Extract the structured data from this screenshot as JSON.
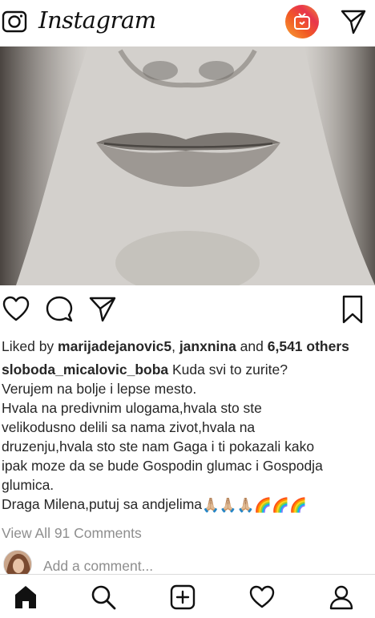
{
  "header": {
    "logo_text": "Instagram",
    "camera_icon": "camera-icon",
    "igtv_icon": "igtv-icon",
    "direct_icon": "paper-plane-icon",
    "igtv_color": "#f15a24"
  },
  "post": {
    "image_description_icon": "post-photo",
    "actions": [
      "heart-icon",
      "comment-icon",
      "share-icon",
      "bookmark-icon"
    ],
    "liked_prefix": "Liked by ",
    "liked_user1": "marijadejanovic5",
    "liked_sep": ", ",
    "liked_user2": "janxnina",
    "liked_and": " and ",
    "liked_count": "6,541 others",
    "caption_user": "sloboda_micalovic_boba",
    "caption_lines": [
      " Kuda svi to zurite?",
      "Verujem na bolje i lepse mesto.",
      "Hvala na predivnim ulogama,hvala sto ste",
      "velikodusno delili sa nama zivot,hvala na",
      "druzenju,hvala sto ste nam Gaga i ti pokazali kako",
      "ipak moze da se bude Gospodin glumac i Gospodja",
      "glumica.",
      "Draga Milena,putuj sa andjelima"
    ],
    "caption_emojis": "🙏🏼🙏🏼🙏🏼🌈🌈🌈",
    "view_all": "View All 91 Comments",
    "add_comment_placeholder": "Add a comment..."
  },
  "bottom_nav": [
    "home-icon",
    "search-icon",
    "new-post-icon",
    "activity-heart-icon",
    "profile-icon"
  ]
}
